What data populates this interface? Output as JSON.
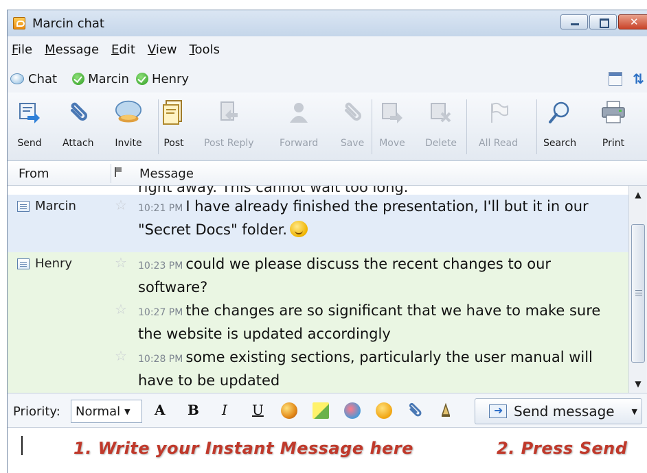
{
  "window": {
    "title": "Marcin chat"
  },
  "menu": [
    {
      "label": "File",
      "key": "F",
      "rest": "ile"
    },
    {
      "label": "Message",
      "key": "M",
      "rest": "essage"
    },
    {
      "label": "Edit",
      "key": "E",
      "rest": "dit"
    },
    {
      "label": "View",
      "key": "V",
      "rest": "iew"
    },
    {
      "label": "Tools",
      "key": "T",
      "rest": "ools"
    }
  ],
  "participants": {
    "chat_label": "Chat",
    "people": [
      "Marcin",
      "Henry"
    ]
  },
  "toolbar": {
    "send": "Send",
    "attach": "Attach",
    "invite": "Invite",
    "post": "Post",
    "post_reply": "Post Reply",
    "forward": "Forward",
    "save": "Save",
    "move": "Move",
    "delete": "Delete",
    "all_read": "All Read",
    "search": "Search",
    "print": "Print"
  },
  "columns": {
    "from": "From",
    "message": "Message"
  },
  "clipped_text": "right away. This cannot wait too long.",
  "messages": [
    {
      "sender": "Marcin",
      "time": "10:21 PM",
      "text": "I have already finished the presentation, I'll but it in our \"Secret Docs\" folder."
    },
    {
      "sender": "Henry",
      "time": "10:23 PM",
      "text": "could we please discuss the recent changes to our software?"
    },
    {
      "sender": "",
      "time": "10:27 PM",
      "text": "the changes are so significant that we have to make sure the website is updated accordingly"
    },
    {
      "sender": "",
      "time": "10:28 PM",
      "text": "some existing sections, particularly the user manual will have to be updated"
    }
  ],
  "compose": {
    "priority_label": "Priority:",
    "priority_value": "Normal",
    "send_message": "Send message",
    "hint_write": "1. Write your Instant Message here",
    "hint_send": "2. Press Send"
  },
  "format_buttons": {
    "bold": "B",
    "italic": "I",
    "underline": "U",
    "font_size": "A"
  }
}
